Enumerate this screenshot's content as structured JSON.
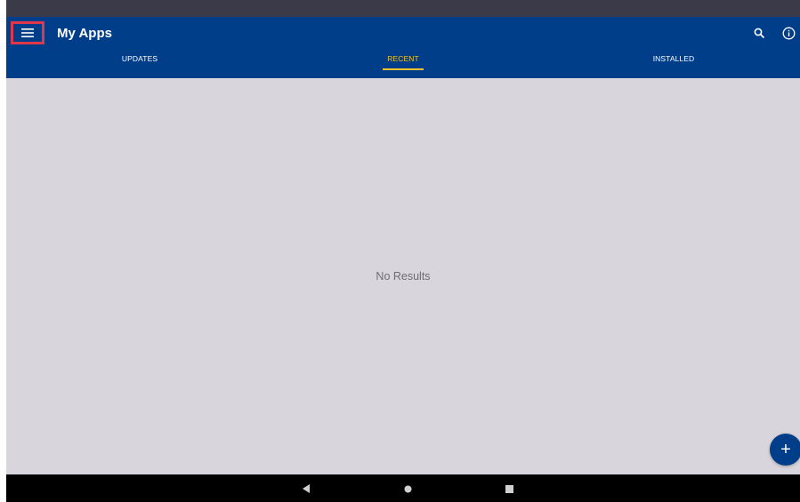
{
  "app_bar": {
    "title": "My Apps",
    "menu_icon": "hamburger-menu-icon",
    "search_icon": "search-icon",
    "info_icon": "info-icon",
    "background_color": "#003e8a",
    "highlight_color": "#e0384a"
  },
  "tabs": [
    {
      "label": "UPDATES",
      "active": false
    },
    {
      "label": "RECENT",
      "active": true
    },
    {
      "label": "INSTALLED",
      "active": false
    }
  ],
  "accent_color": "#f1c232",
  "content": {
    "empty_message": "No Results"
  },
  "fab": {
    "label": "+",
    "icon": "add-icon"
  },
  "nav_bar": {
    "back_icon": "back-triangle-icon",
    "home_icon": "home-circle-icon",
    "recents_icon": "recents-square-icon"
  }
}
